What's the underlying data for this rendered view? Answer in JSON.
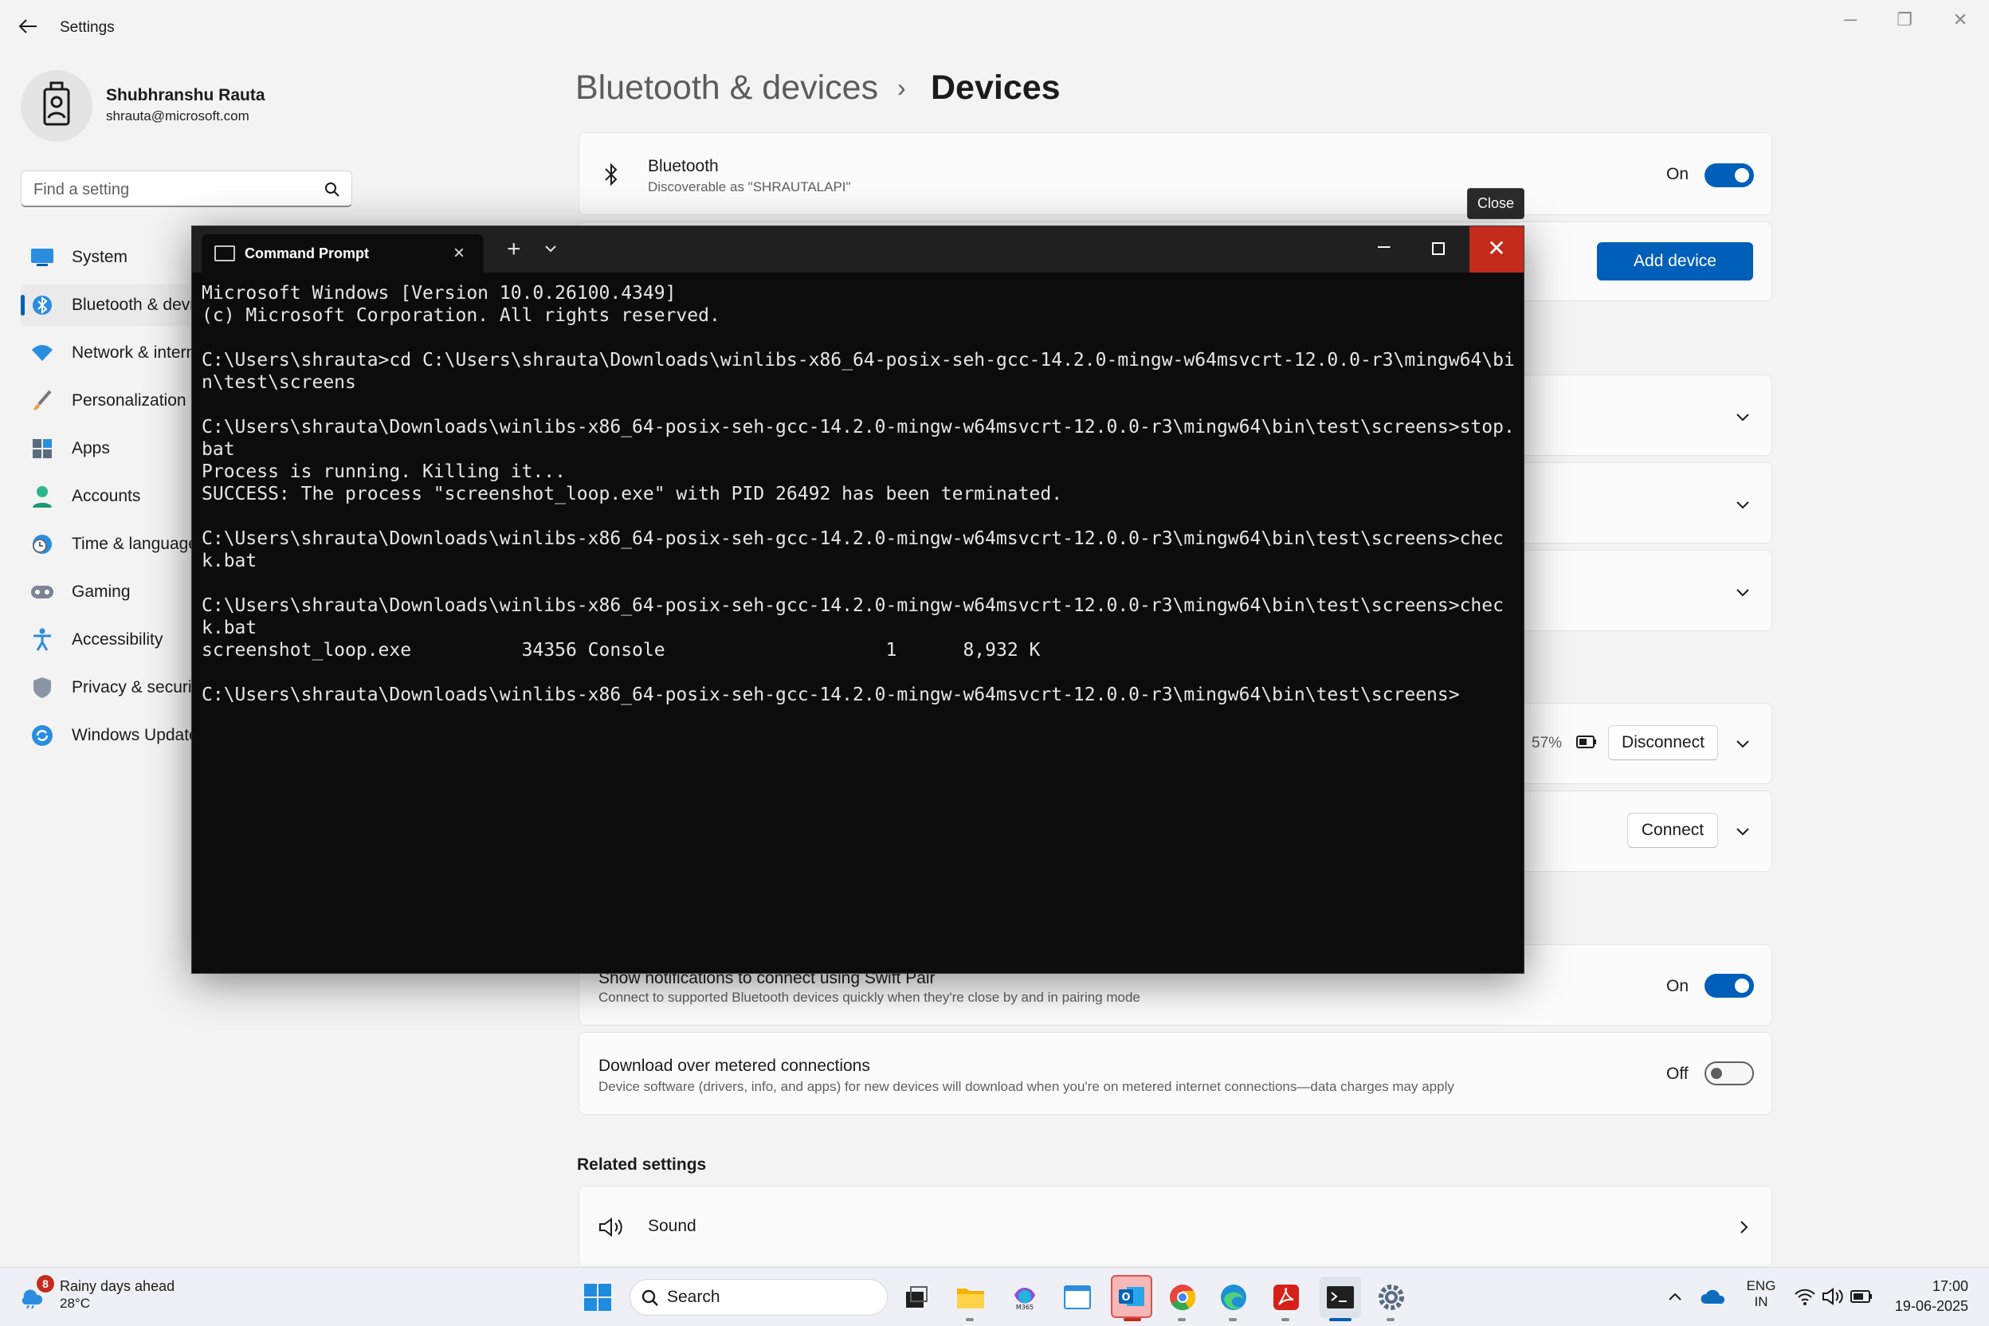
{
  "settings": {
    "window_title": "Settings",
    "user": {
      "name": "Shubhranshu Rauta",
      "email": "shrauta@microsoft.com"
    },
    "search_placeholder": "Find a setting",
    "nav": [
      {
        "label": "System",
        "icon": "monitor-icon"
      },
      {
        "label": "Bluetooth & devices",
        "icon": "bluetooth-icon"
      },
      {
        "label": "Network & internet",
        "icon": "wifi-icon"
      },
      {
        "label": "Personalization",
        "icon": "brush-icon"
      },
      {
        "label": "Apps",
        "icon": "apps-icon"
      },
      {
        "label": "Accounts",
        "icon": "person-icon"
      },
      {
        "label": "Time & language",
        "icon": "clock-globe-icon"
      },
      {
        "label": "Gaming",
        "icon": "gamepad-icon"
      },
      {
        "label": "Accessibility",
        "icon": "accessibility-icon"
      },
      {
        "label": "Privacy & security",
        "icon": "shield-icon"
      },
      {
        "label": "Windows Update",
        "icon": "update-icon"
      }
    ],
    "breadcrumb": {
      "parent": "Bluetooth & devices",
      "separator": "›",
      "current": "Devices"
    },
    "bluetooth_card": {
      "title": "Bluetooth",
      "subtitle": "Discoverable as \"SHRAUTALAPI\"",
      "state": "On"
    },
    "add_device_label": "Add device",
    "device_rows": {
      "battery": "57%",
      "disconnect_label": "Disconnect",
      "connect_label": "Connect"
    },
    "swift_pair": {
      "title": "Show notifications to connect using Swift Pair",
      "subtitle": "Connect to supported Bluetooth devices quickly when they're close by and in pairing mode",
      "state": "On"
    },
    "metered": {
      "title": "Download over metered connections",
      "subtitle": "Device software (drivers, info, and apps) for new devices will download when you're on metered internet connections—data charges may apply",
      "state": "Off"
    },
    "related_settings_title": "Related settings",
    "sound_label": "Sound"
  },
  "tooltip": "Close",
  "cmd": {
    "tab_title": "Command Prompt",
    "output": "Microsoft Windows [Version 10.0.26100.4349]\n(c) Microsoft Corporation. All rights reserved.\n\nC:\\Users\\shrauta>cd C:\\Users\\shrauta\\Downloads\\winlibs-x86_64-posix-seh-gcc-14.2.0-mingw-w64msvcrt-12.0.0-r3\\mingw64\\bin\\test\\screens\n\nC:\\Users\\shrauta\\Downloads\\winlibs-x86_64-posix-seh-gcc-14.2.0-mingw-w64msvcrt-12.0.0-r3\\mingw64\\bin\\test\\screens>stop.bat\nProcess is running. Killing it...\nSUCCESS: The process \"screenshot_loop.exe\" with PID 26492 has been terminated.\n\nC:\\Users\\shrauta\\Downloads\\winlibs-x86_64-posix-seh-gcc-14.2.0-mingw-w64msvcrt-12.0.0-r3\\mingw64\\bin\\test\\screens>check.bat\n\nC:\\Users\\shrauta\\Downloads\\winlibs-x86_64-posix-seh-gcc-14.2.0-mingw-w64msvcrt-12.0.0-r3\\mingw64\\bin\\test\\screens>check.bat\nscreenshot_loop.exe          34356 Console                    1      8,932 K\n\nC:\\Users\\shrauta\\Downloads\\winlibs-x86_64-posix-seh-gcc-14.2.0-mingw-w64msvcrt-12.0.0-r3\\mingw64\\bin\\test\\screens>"
  },
  "taskbar": {
    "weather_text": "Rainy days ahead",
    "weather_temp": "28°C",
    "weather_badge": "8",
    "search_label": "Search",
    "lang_line1": "ENG",
    "lang_line2": "IN",
    "time": "17:00",
    "date": "19-06-2025"
  },
  "colors": {
    "accent": "#005fb8",
    "close_red": "#c42b1c",
    "terminal_bg": "#0c0c0c"
  }
}
